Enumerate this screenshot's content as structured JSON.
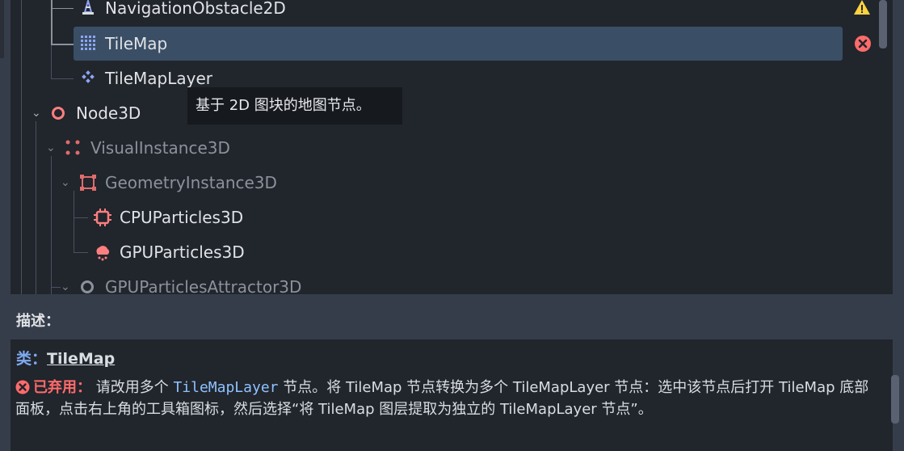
{
  "tree": {
    "items": [
      {
        "label": "NavigationObstacle2D",
        "icon": "navigation-obstacle-icon",
        "status": "warning-icon",
        "dim": false
      },
      {
        "label": "TileMap",
        "icon": "tilemap-grid-icon",
        "status": "error-icon",
        "dim": false,
        "selected": true
      },
      {
        "label": "TileMapLayer",
        "icon": "tilemap-layer-icon",
        "dim": false
      },
      {
        "label": "Node3D",
        "icon": "node3d-circle-icon",
        "dim": false
      },
      {
        "label": "VisualInstance3D",
        "icon": "visual-instance-icon",
        "dim": true
      },
      {
        "label": "GeometryInstance3D",
        "icon": "geometry-instance-icon",
        "dim": true
      },
      {
        "label": "CPUParticles3D",
        "icon": "cpu-particles-icon",
        "dim": false
      },
      {
        "label": "GPUParticles3D",
        "icon": "gpu-particles-icon",
        "dim": false
      },
      {
        "label": "GPUParticlesAttractor3D",
        "icon": "particles-attractor-icon",
        "dim": true
      }
    ]
  },
  "tooltip": {
    "text": "基于 2D 图块的地图节点。"
  },
  "description": {
    "title": "描述：",
    "class_prefix": "类：",
    "class_name": "TileMap",
    "deprecated_label": "已弃用：",
    "text_before": " 请改用多个 ",
    "code": "TileMapLayer",
    "text_after": " 节点。将 TileMap 节点转换为多个 TileMapLayer 节点：选中该节点后打开 TileMap 底部面板，点击右上角的工具箱图标，然后选择“将 TileMap 图层提取为独立的 TileMapLayer 节点”。"
  },
  "colors": {
    "error": "#ff6b6b",
    "warning": "#ffd23f",
    "selected": "#3a4f66",
    "node3d": "#fc7f7f",
    "node2d": "#8da5f3"
  }
}
